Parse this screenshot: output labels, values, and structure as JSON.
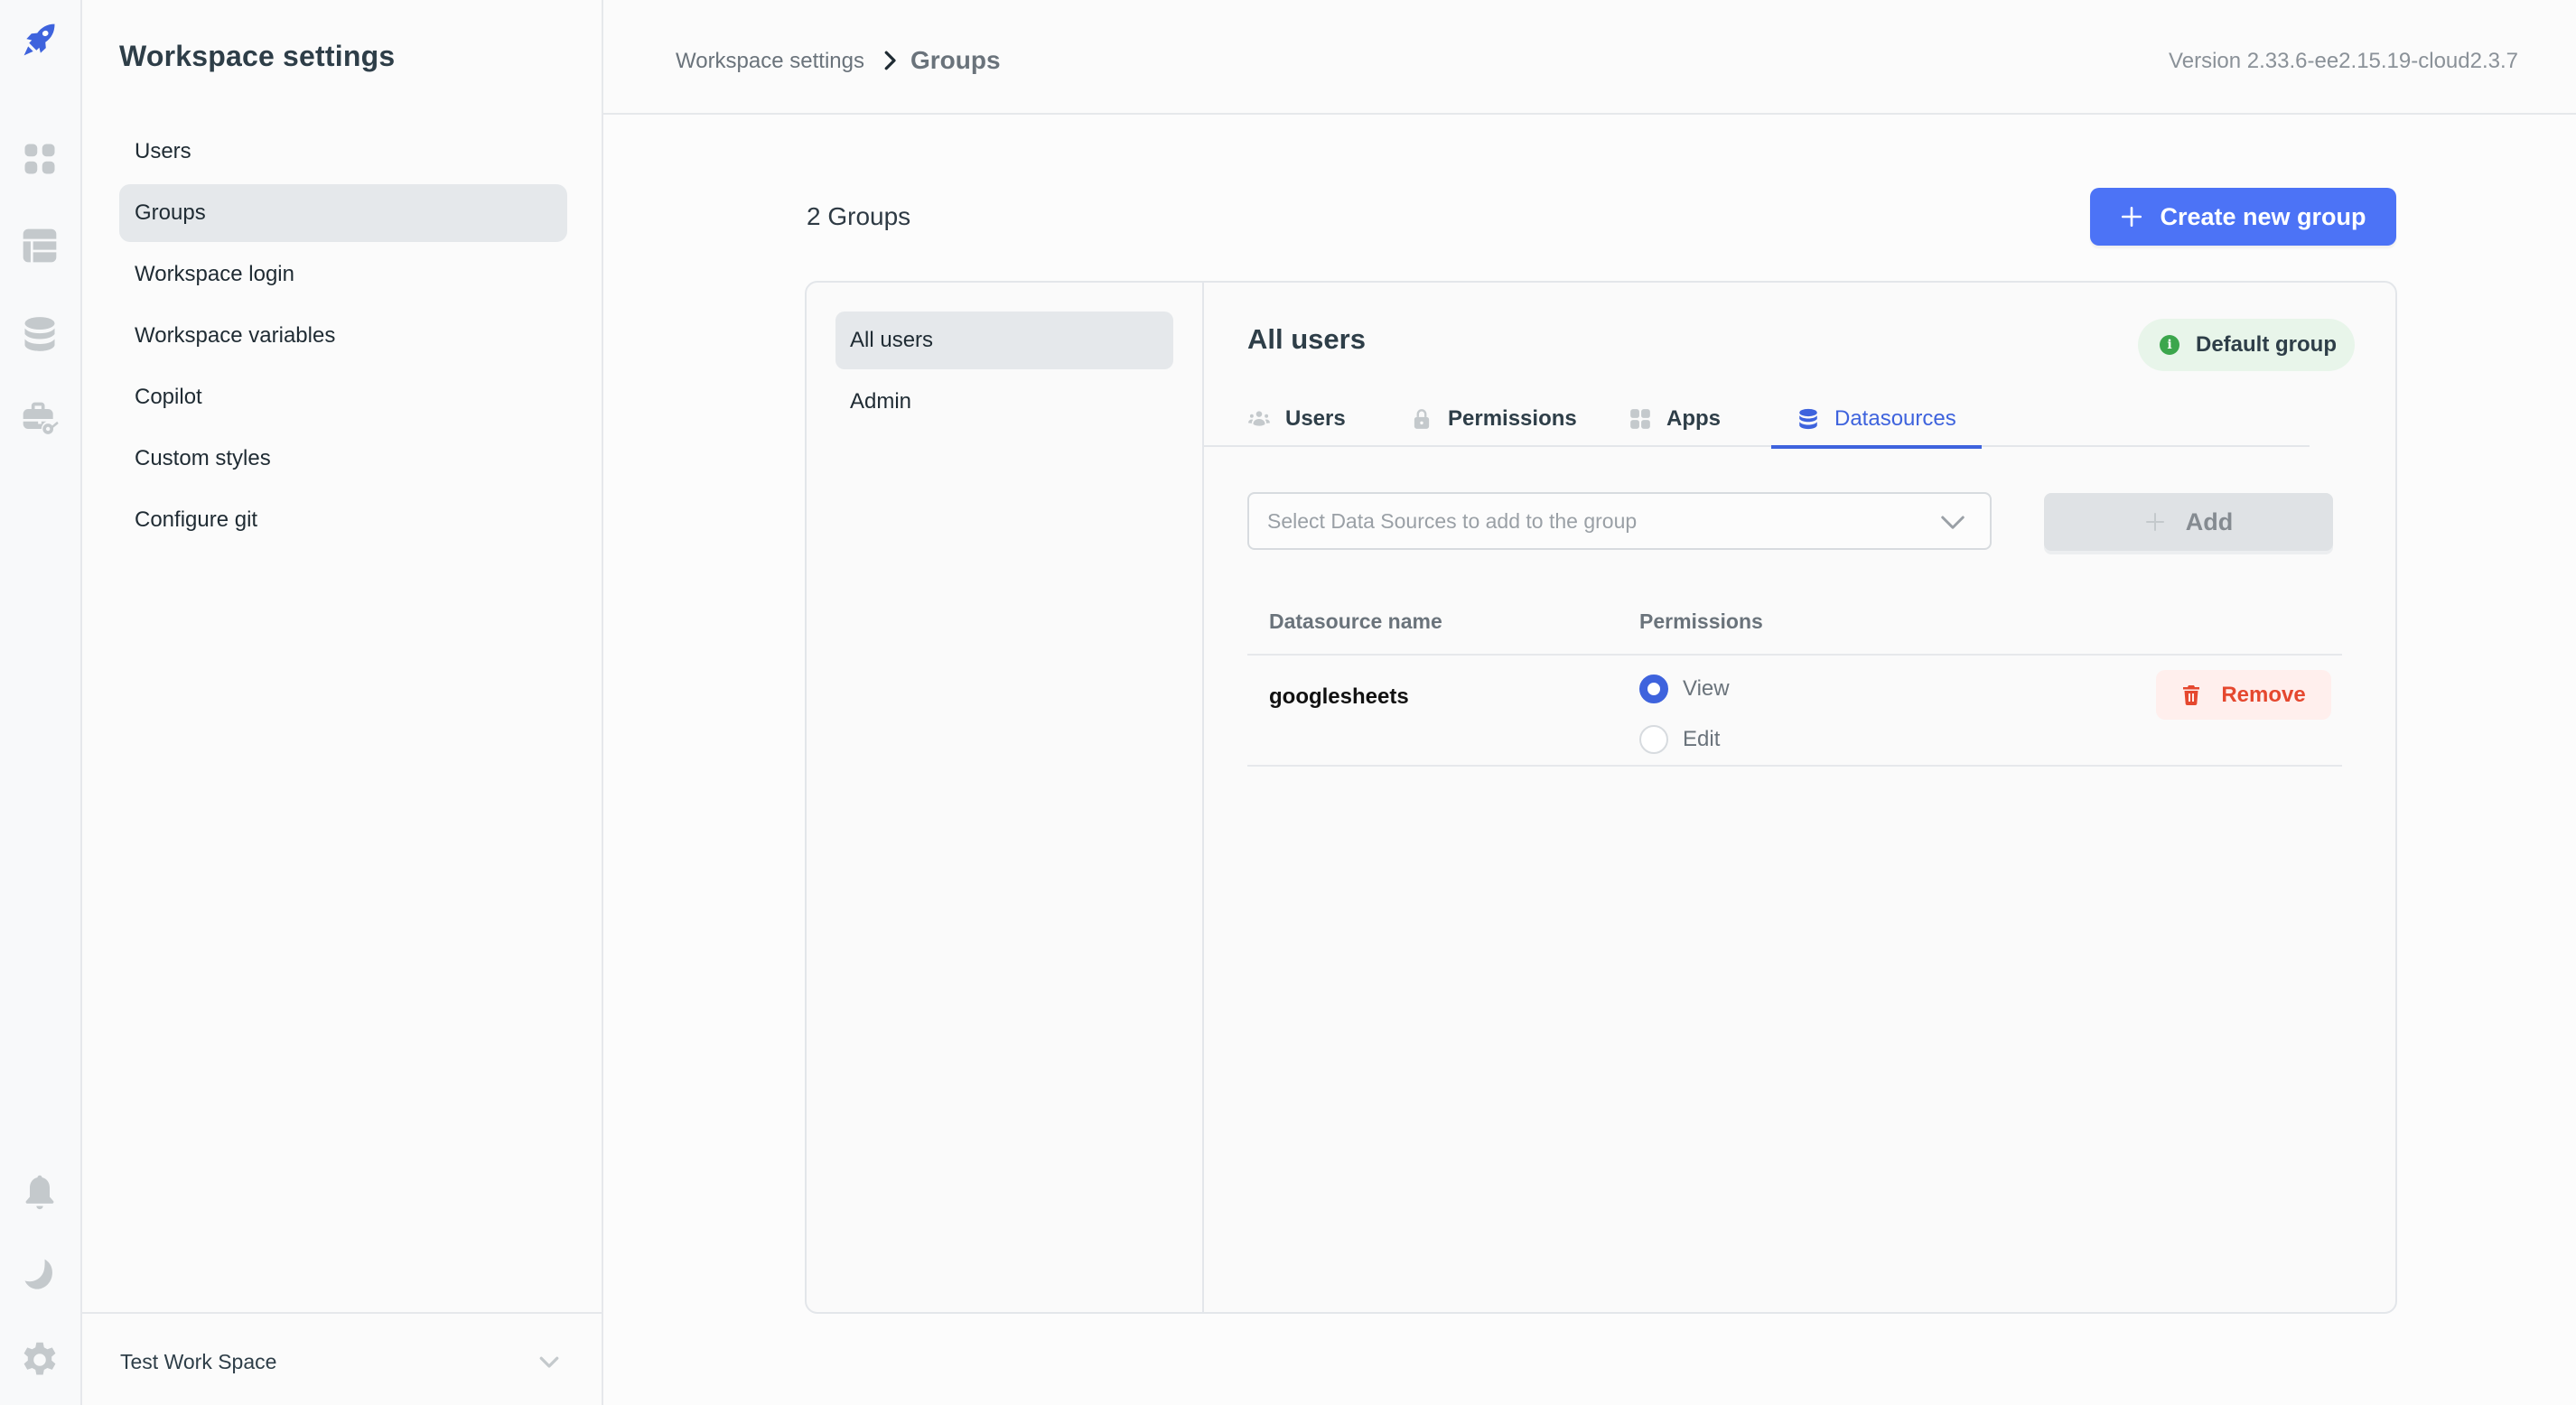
{
  "rail": {
    "icons": [
      "rocket-logo-icon",
      "apps-grid-icon",
      "table-icon",
      "database-icon",
      "workflow-key-icon",
      "bell-icon",
      "moon-icon",
      "gear-icon"
    ],
    "brand_color": "#3e63dd"
  },
  "sidebar": {
    "title": "Workspace settings",
    "items": [
      {
        "label": "Users",
        "active": false
      },
      {
        "label": "Groups",
        "active": true
      },
      {
        "label": "Workspace login",
        "active": false
      },
      {
        "label": "Workspace variables",
        "active": false
      },
      {
        "label": "Copilot",
        "active": false
      },
      {
        "label": "Custom styles",
        "active": false
      },
      {
        "label": "Configure git",
        "active": false
      }
    ],
    "workspace_name": "Test Work Space"
  },
  "header": {
    "breadcrumb_root": "Workspace settings",
    "breadcrumb_current": "Groups",
    "version": "Version 2.33.6-ee2.15.19-cloud2.3.7"
  },
  "main": {
    "groups_count": "2 Groups",
    "create_button": "Create new group",
    "groups": [
      {
        "label": "All users",
        "active": true
      },
      {
        "label": "Admin",
        "active": false
      }
    ],
    "detail": {
      "title": "All users",
      "badge": "Default group",
      "tabs": [
        {
          "label": "Users",
          "icon": "users-icon",
          "active": false
        },
        {
          "label": "Permissions",
          "icon": "lock-icon",
          "active": false
        },
        {
          "label": "Apps",
          "icon": "apps-grid-icon",
          "active": false
        },
        {
          "label": "Datasources",
          "icon": "database-icon",
          "active": true
        }
      ],
      "select_placeholder": "Select Data Sources to add to the group",
      "add_button": "Add",
      "table": {
        "headers": [
          "Datasource name",
          "Permissions"
        ],
        "rows": [
          {
            "name": "googlesheets",
            "permissions": [
              {
                "label": "View",
                "checked": true
              },
              {
                "label": "Edit",
                "checked": false
              }
            ],
            "action": "Remove"
          }
        ]
      }
    }
  },
  "colors": {
    "accent": "#4c73f6",
    "tab_active": "#3e63dd",
    "danger": "#e5482f",
    "success": "#3ba64c"
  }
}
